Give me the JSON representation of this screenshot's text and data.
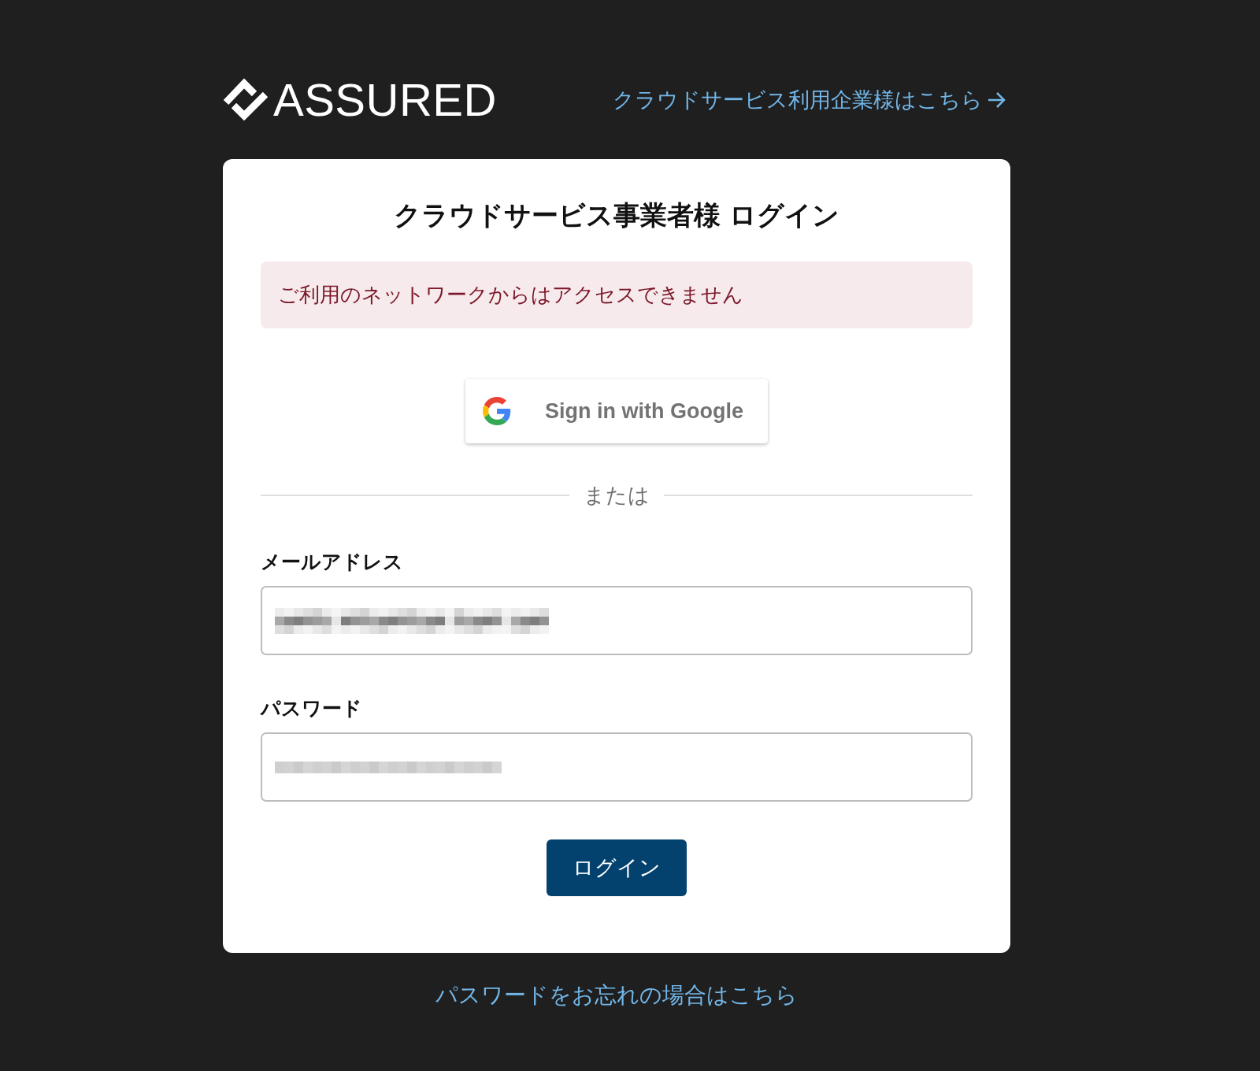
{
  "header": {
    "logo": {
      "wordmark": "ASSURED"
    },
    "company_link": {
      "label": "クラウドサービス利用企業様はこちら"
    }
  },
  "login_card": {
    "title": "クラウドサービス事業者様 ログイン",
    "alert": {
      "kind": "error",
      "message": "ご利用のネットワークからはアクセスできません"
    },
    "google_button": {
      "label": "Sign in with Google"
    },
    "divider": {
      "label": "または"
    },
    "fields": [
      {
        "kind": "email",
        "label": "メールアドレス",
        "obscured": true
      },
      {
        "kind": "password",
        "label": "パスワード",
        "obscured": true
      }
    ],
    "submit_button": {
      "label": "ログイン"
    }
  },
  "forgot_password_link": {
    "label": "パスワードをお忘れの場合はこちら"
  }
}
